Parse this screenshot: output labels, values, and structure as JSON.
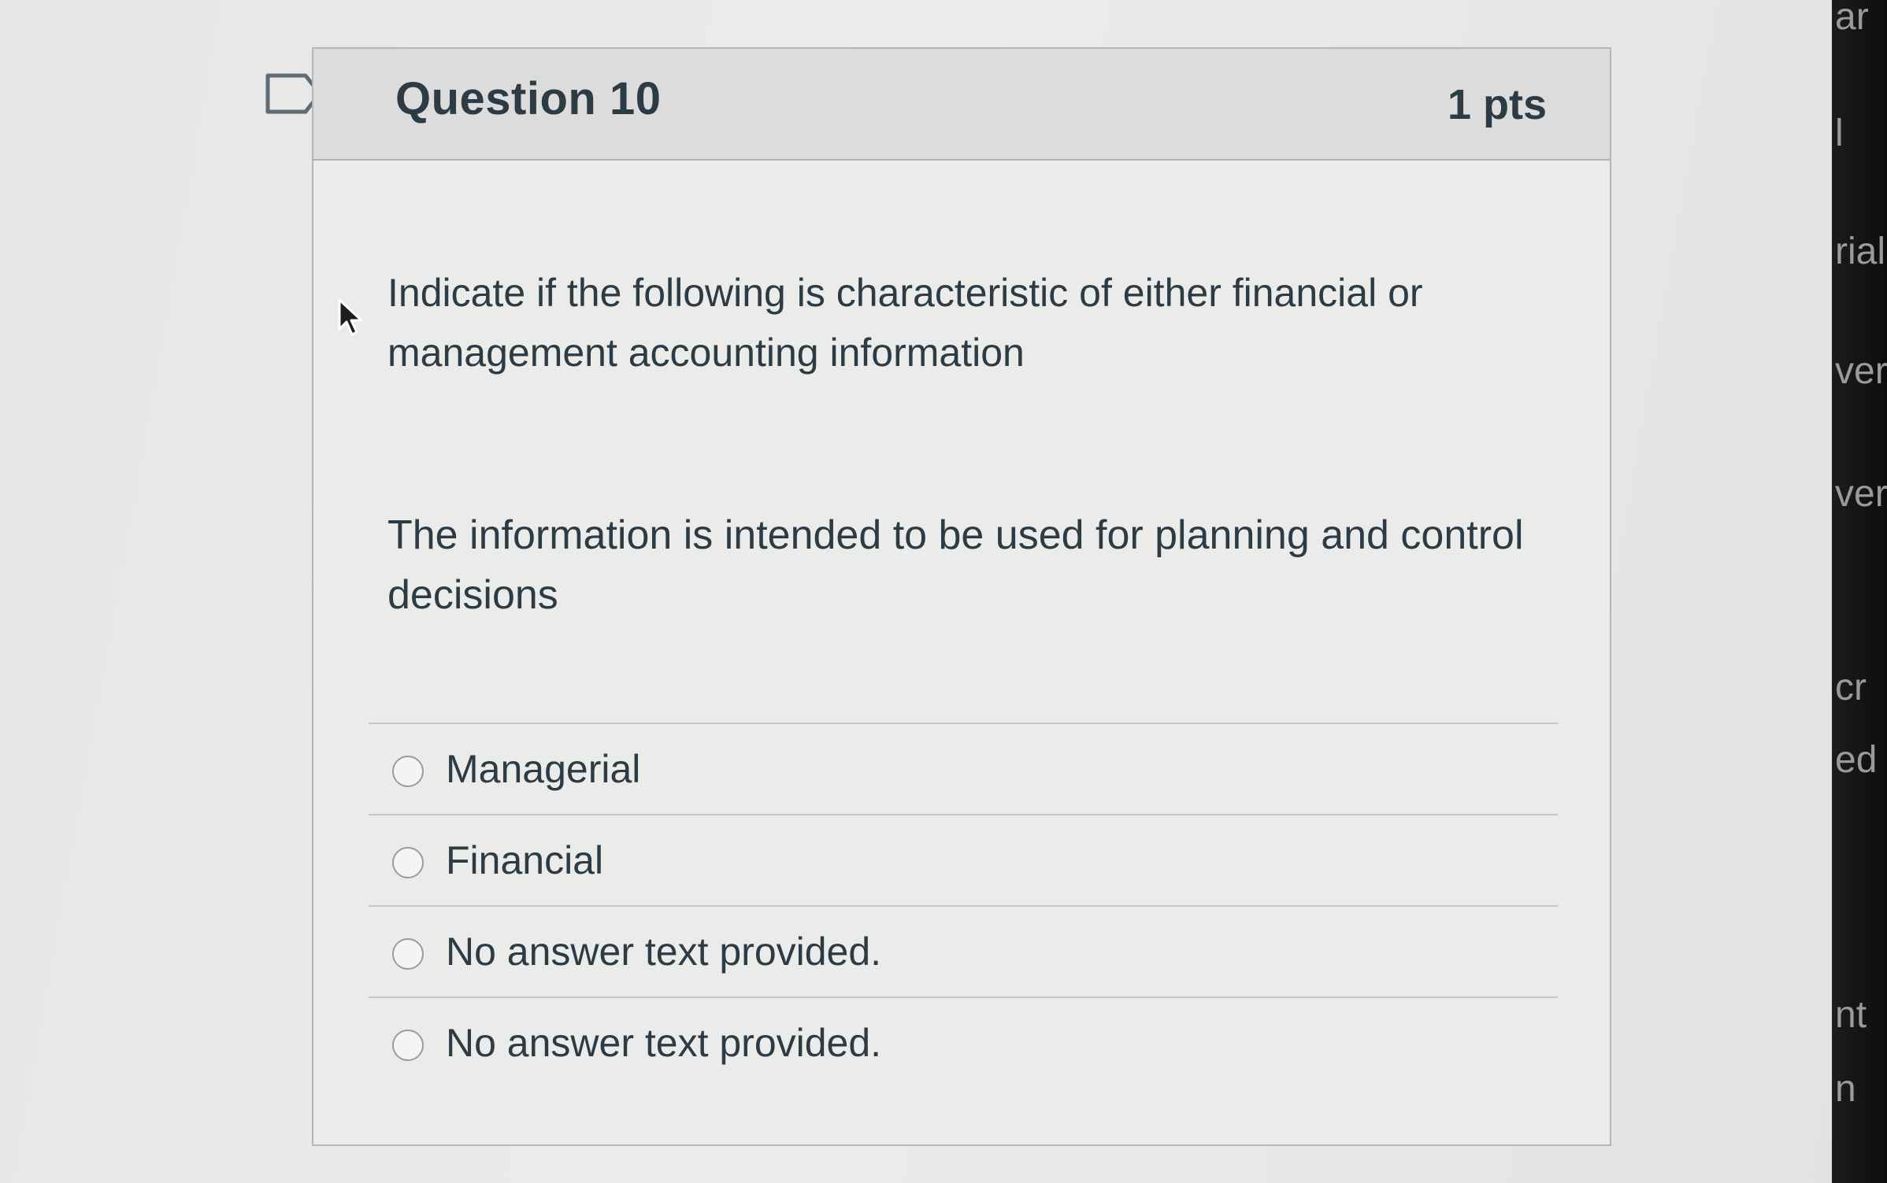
{
  "question": {
    "title": "Question 10",
    "points": "1 pts",
    "prompt": "Indicate if the following is characteristic of either financial or management accounting information",
    "statement": "The information is intended to be used for planning and control decisions",
    "answers": [
      {
        "label": "Managerial"
      },
      {
        "label": "Financial"
      },
      {
        "label": "No answer text provided."
      },
      {
        "label": "No answer text provided."
      }
    ]
  },
  "side_panel": {
    "fragments": [
      "ar",
      "l",
      "rial",
      "ver",
      "ver",
      "cr",
      "ed",
      "nt",
      "n"
    ]
  },
  "colors": {
    "text": "#2d3b45",
    "header_bg": "#dcdcdc",
    "border": "#b4b6b8",
    "side_panel": "#141414"
  }
}
